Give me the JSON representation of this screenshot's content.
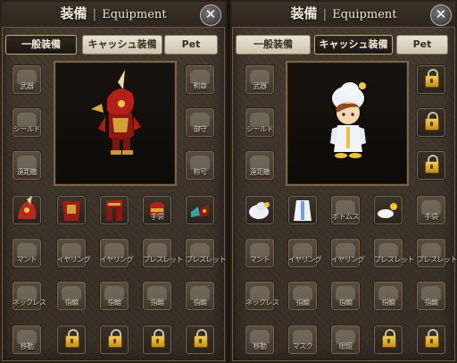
{
  "left": {
    "title_jp": "装備",
    "title_sep": "|",
    "title_en": "Equipment",
    "close_icon": "close-icon",
    "tabs": [
      {
        "label": "一般装備",
        "active": true
      },
      {
        "label": "キャッシュ装備",
        "active": false
      },
      {
        "label": "Pet",
        "active": false
      }
    ],
    "slots": {
      "weapon": "武器",
      "medal": "勲章",
      "shield": "シールド",
      "charm": "御守",
      "ranged": "遠距離",
      "badge": "称号",
      "glove": "手袋",
      "mantle": "マント",
      "earring": "イヤリング",
      "bracelet": "ブレスレット",
      "necklace": "ネックレス",
      "ring": "指輪",
      "move": "移動"
    }
  },
  "right": {
    "title_jp": "装備",
    "title_sep": "|",
    "title_en": "Equipment",
    "close_icon": "close-icon",
    "tabs": [
      {
        "label": "一般装備",
        "active": false
      },
      {
        "label": "キャッシュ装備",
        "active": true
      },
      {
        "label": "Pet",
        "active": false
      }
    ],
    "slots": {
      "weapon": "武器",
      "shield": "シールド",
      "ranged": "遠距離",
      "bottoms": "ボトムス",
      "glove": "手袋",
      "mantle": "マント",
      "earring": "イヤリング",
      "bracelet": "ブレスレット",
      "necklace": "ネックレス",
      "ring": "指輪",
      "move": "移動",
      "mask": "マスク",
      "glasses": "眼鏡"
    }
  },
  "colors": {
    "panel": "#4a3f33",
    "lock": "#e8b52e",
    "active_tab": "#1b1712"
  }
}
